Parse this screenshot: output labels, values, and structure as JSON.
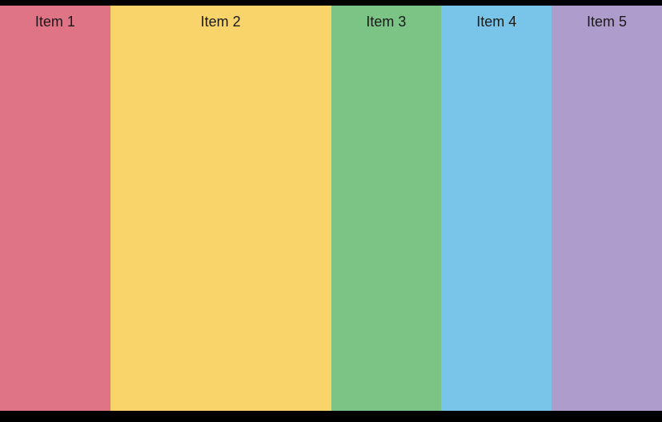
{
  "items": [
    {
      "label": "Item 1"
    },
    {
      "label": "Item 2"
    },
    {
      "label": "Item 3"
    },
    {
      "label": "Item 4"
    },
    {
      "label": "Item 5"
    }
  ]
}
